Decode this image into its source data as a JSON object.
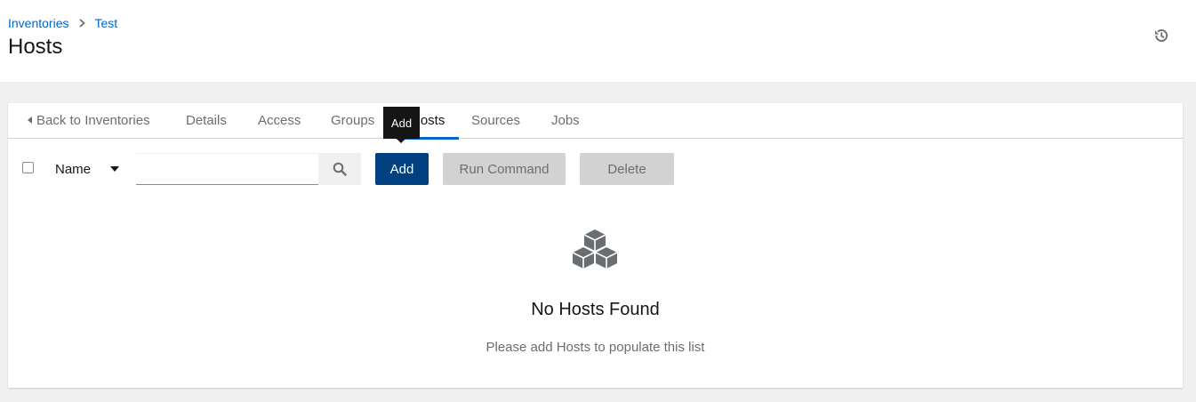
{
  "breadcrumb": {
    "items": [
      "Inventories",
      "Test"
    ]
  },
  "page": {
    "title": "Hosts"
  },
  "tabs": [
    {
      "label": "Back to Inventories"
    },
    {
      "label": "Details"
    },
    {
      "label": "Access"
    },
    {
      "label": "Groups"
    },
    {
      "label": "Hosts"
    },
    {
      "label": "Sources"
    },
    {
      "label": "Jobs"
    }
  ],
  "active_tab": "Hosts",
  "tooltip": {
    "text": "Add"
  },
  "toolbar": {
    "filter_label": "Name",
    "search_value": "",
    "add_label": "Add",
    "run_command_label": "Run Command",
    "delete_label": "Delete"
  },
  "empty_state": {
    "icon": "cubes-icon",
    "title": "No Hosts Found",
    "body": "Please add Hosts to populate this list"
  },
  "colors": {
    "link": "#0066cc",
    "primary_button": "#004080",
    "disabled_button": "#d2d2d2",
    "active_tab_underline": "#0066cc"
  }
}
